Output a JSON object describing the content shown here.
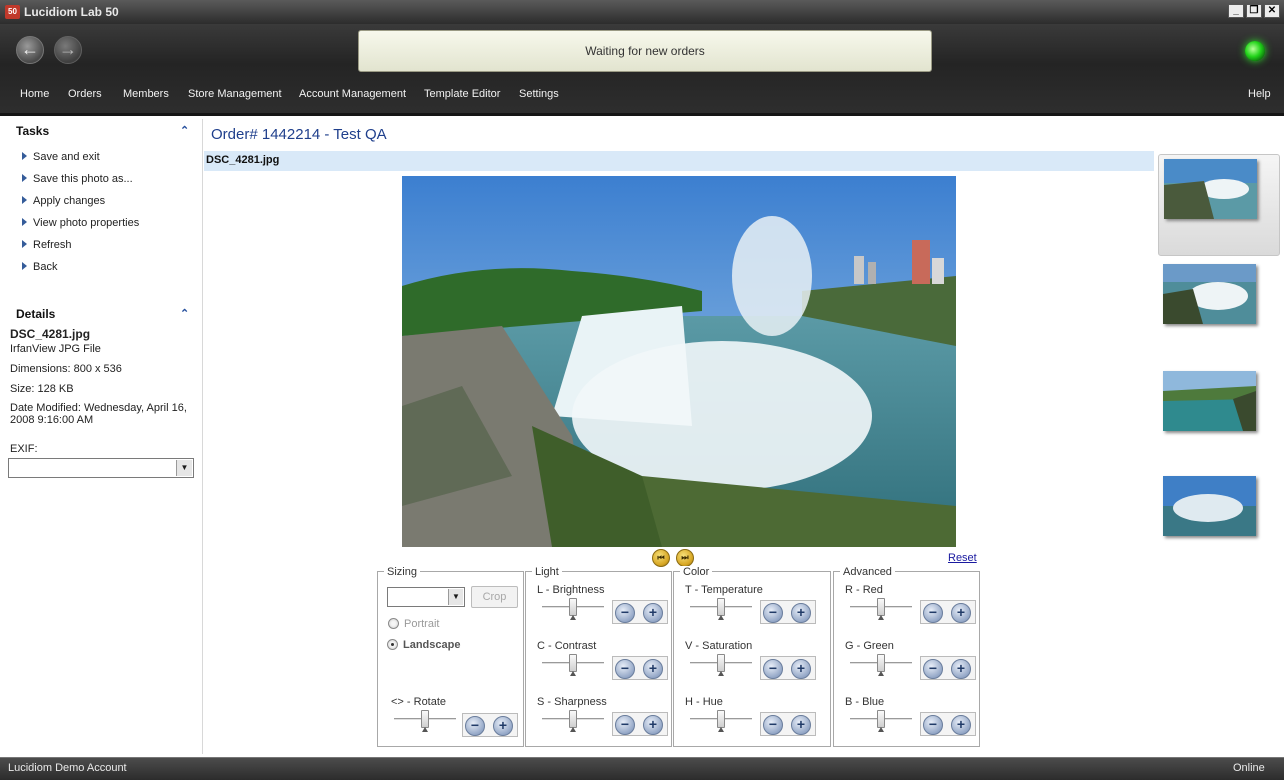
{
  "window": {
    "app_logo": "50",
    "title": "Lucidiom Lab 50",
    "minimize": "_",
    "restore": "❐",
    "close": "✕"
  },
  "toolbar": {
    "back_icon": "back-arrow-icon",
    "forward_icon": "forward-arrow-icon",
    "status_message": "Waiting for new orders",
    "status_led_color": "#22d41a"
  },
  "menu": {
    "items": [
      "Home",
      "Orders",
      "Members",
      "Store Management",
      "Account Management",
      "Template Editor",
      "Settings"
    ],
    "help": "Help"
  },
  "sidebar": {
    "tasks_title": "Tasks",
    "tasks": [
      "Save and exit",
      "Save this photo as...",
      "Apply changes",
      "View photo properties",
      "Refresh",
      "Back"
    ],
    "details_title": "Details",
    "details": {
      "filename": "DSC_4281.jpg",
      "type": "IrfanView JPG File",
      "dimensions": "Dimensions: 800 x 536",
      "size": "Size: 128 KB",
      "date_modified_1": "Date Modified: Wednesday, April 16,",
      "date_modified_2": "2008 9:16:00 AM",
      "exif_label": "EXIF:",
      "exif_value": ""
    }
  },
  "main": {
    "order_title": "Order# 1442214 - Test  QA",
    "file_bar": "DSC_4281.jpg",
    "reset_link": "Reset",
    "prev_button": "prev-photo-icon",
    "next_button": "next-photo-icon"
  },
  "controls": {
    "sizing": {
      "title": "Sizing",
      "size_value": "",
      "crop_label": "Crop",
      "portrait_label": "Portrait",
      "landscape_label": "Landscape",
      "selected_orientation": "Landscape",
      "rotate_label": "<> - Rotate"
    },
    "light": {
      "title": "Light",
      "brightness_label": "L - Brightness",
      "contrast_label": "C - Contrast",
      "sharpness_label": "S - Sharpness"
    },
    "color": {
      "title": "Color",
      "temperature_label": "T - Temperature",
      "saturation_label": "V - Saturation",
      "hue_label": "H - Hue"
    },
    "advanced": {
      "title": "Advanced",
      "red_label": "R - Red",
      "green_label": "G - Green",
      "blue_label": "B - Blue"
    },
    "minus": "−",
    "plus": "+"
  },
  "status_bar": {
    "account": "Lucidiom Demo Account",
    "connection": "Online"
  }
}
